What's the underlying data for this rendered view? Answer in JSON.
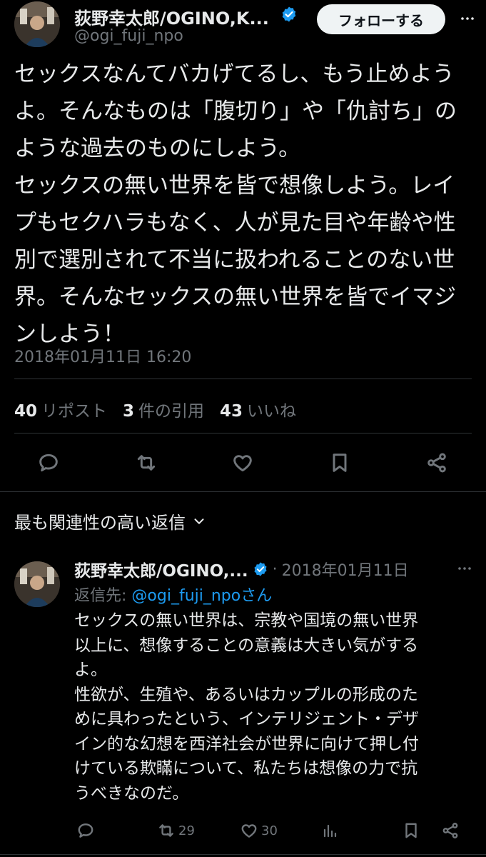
{
  "tweet": {
    "author_name": "荻野幸太郎/OGINO,K...",
    "author_handle": "@ogi_fuji_npo",
    "follow_label": "フォローする",
    "more_icon": "more-dots-icon",
    "text": "セックスなんてバカげてるし、もう止めよう\nよ。そんなものは「腹切り」や「仇討ち」の\nような過去のものにしよう。\nセックスの無い世界を皆で想像しよう。レイ\nプもセクハラもなく、人が見た目や年齢や性\n別で選別されて不当に扱われることのない世\n界。そんなセックスの無い世界を皆でイマジ\nンしよう！",
    "timestamp": "2018年01月11日 16:20",
    "stats": {
      "reposts_count": "40",
      "reposts_label": "リポスト",
      "quotes_count": "3",
      "quotes_label": "件の引用",
      "likes_count": "43",
      "likes_label": "いいね"
    },
    "actions": [
      "reply-icon",
      "repost-icon",
      "like-icon",
      "bookmark-icon",
      "share-icon"
    ]
  },
  "replies_header": {
    "label": "最も関連性の高い返信",
    "icon": "chevron-down-icon"
  },
  "reply": {
    "author_name": "荻野幸太郎/OGINO,...",
    "separator": "·",
    "date": "2018年01月11日",
    "replying_prefix": "返信先: ",
    "replying_handle": "@ogi_fuji_npo",
    "replying_suffix": "さん",
    "text": "セックスの無い世界は、宗教や国境の無い世界\n以上に、想像することの意義は大きい気がする\nよ。\n性欲が、生殖や、あるいはカップルの形成のた\nめに具わったという、インテリジェント・デザ\nイン的な幻想を西洋社会が世界に向けて押し付\nけている欺瞞について、私たちは想像の力で抗\nうべきなのだ。",
    "reposts": "29",
    "likes": "30"
  },
  "colors": {
    "background": "#000000",
    "text": "#e7e9ea",
    "secondary": "#71767b",
    "verified": "#1d9bf0",
    "link": "#1d9bf0",
    "follow_bg": "#eff3f4"
  }
}
